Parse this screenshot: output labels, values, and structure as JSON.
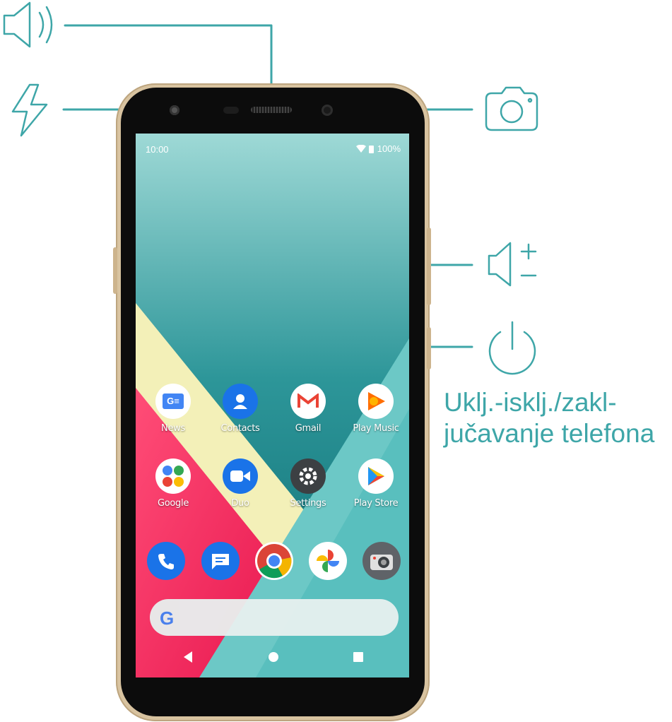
{
  "callout": {
    "power_label_line1": "Uklj.-isklj./zakl-",
    "power_label_line2": "jučavanje telefona"
  },
  "status_bar": {
    "time": "10:00",
    "battery": "100%"
  },
  "apps": [
    {
      "label": "News",
      "icon": "google-news-icon",
      "color": "#4285f4"
    },
    {
      "label": "Contacts",
      "icon": "contacts-icon",
      "color": "#1a73e8"
    },
    {
      "label": "Gmail",
      "icon": "gmail-icon",
      "color": "#ffffff"
    },
    {
      "label": "Play Music",
      "icon": "play-music-icon",
      "color": "#ff8a00"
    },
    {
      "label": "Google",
      "icon": "google-folder-icon",
      "color": "#ffffff"
    },
    {
      "label": "Duo",
      "icon": "duo-icon",
      "color": "#1a73e8"
    },
    {
      "label": "Settings",
      "icon": "settings-gear-icon",
      "color": "#3c4043"
    },
    {
      "label": "Play Store",
      "icon": "play-store-icon",
      "color": "#ffffff"
    }
  ],
  "dock": [
    "phone-icon",
    "messages-icon",
    "chrome-icon",
    "photos-icon",
    "camera-icon"
  ],
  "search": {
    "logo": "G"
  },
  "colors": {
    "accent": "#3ea6a8",
    "frame": "#d8c3a0"
  }
}
